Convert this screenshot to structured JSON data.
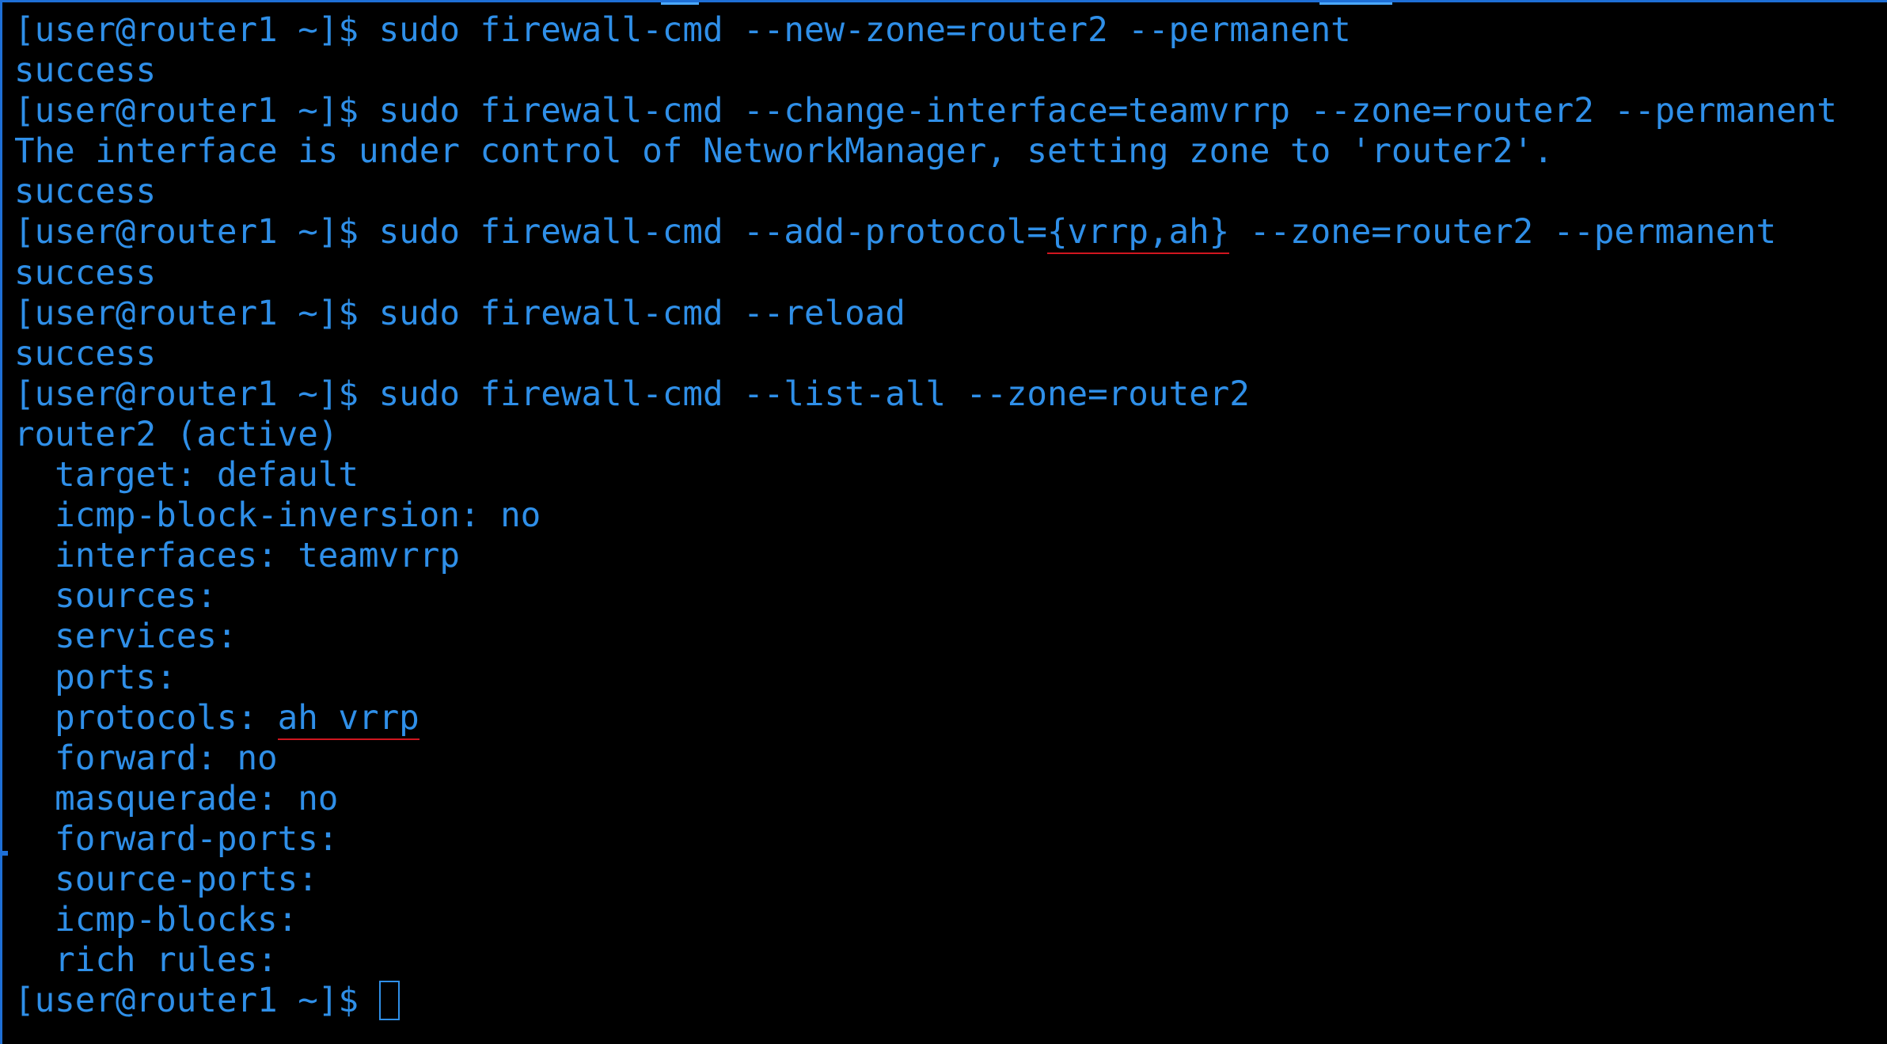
{
  "terminal": {
    "prompt": "[user@router1 ~]$ ",
    "colors": {
      "text": "#2f8fe8",
      "background": "#000000",
      "border": "#1e6fd6",
      "annotation": "#d0161f"
    },
    "lines": [
      {
        "type": "command",
        "cmd": "sudo firewall-cmd --new-zone=router2 --permanent"
      },
      {
        "type": "output",
        "text": "success"
      },
      {
        "type": "command",
        "cmd": "sudo firewall-cmd --change-interface=teamvrrp --zone=router2 --permanent"
      },
      {
        "type": "output",
        "text": "The interface is under control of NetworkManager, setting zone to 'router2'."
      },
      {
        "type": "output",
        "text": "success"
      },
      {
        "type": "command",
        "cmd_pre": "sudo firewall-cmd --add-protocol=",
        "cmd_hl": "{vrrp,ah}",
        "cmd_post": " --zone=router2 --permanent"
      },
      {
        "type": "output",
        "text": "success"
      },
      {
        "type": "command",
        "cmd": "sudo firewall-cmd --reload"
      },
      {
        "type": "output",
        "text": "success"
      },
      {
        "type": "command",
        "cmd": "sudo firewall-cmd --list-all --zone=router2"
      },
      {
        "type": "output",
        "text": "router2 (active)"
      },
      {
        "type": "output",
        "text": "  target: default"
      },
      {
        "type": "output",
        "text": "  icmp-block-inversion: no"
      },
      {
        "type": "output",
        "text": "  interfaces: teamvrrp"
      },
      {
        "type": "output",
        "text": "  sources: "
      },
      {
        "type": "output",
        "text": "  services: "
      },
      {
        "type": "output",
        "text": "  ports: "
      },
      {
        "type": "output",
        "text_pre": "  protocols: ",
        "text_hl": "ah vrrp"
      },
      {
        "type": "output",
        "text": "  forward: no"
      },
      {
        "type": "output",
        "text": "  masquerade: no"
      },
      {
        "type": "output",
        "text": "  forward-ports: "
      },
      {
        "type": "output",
        "text": "  source-ports: "
      },
      {
        "type": "output",
        "text": "  icmp-blocks: "
      },
      {
        "type": "output",
        "text": "  rich rules: "
      },
      {
        "type": "prompt"
      }
    ]
  }
}
